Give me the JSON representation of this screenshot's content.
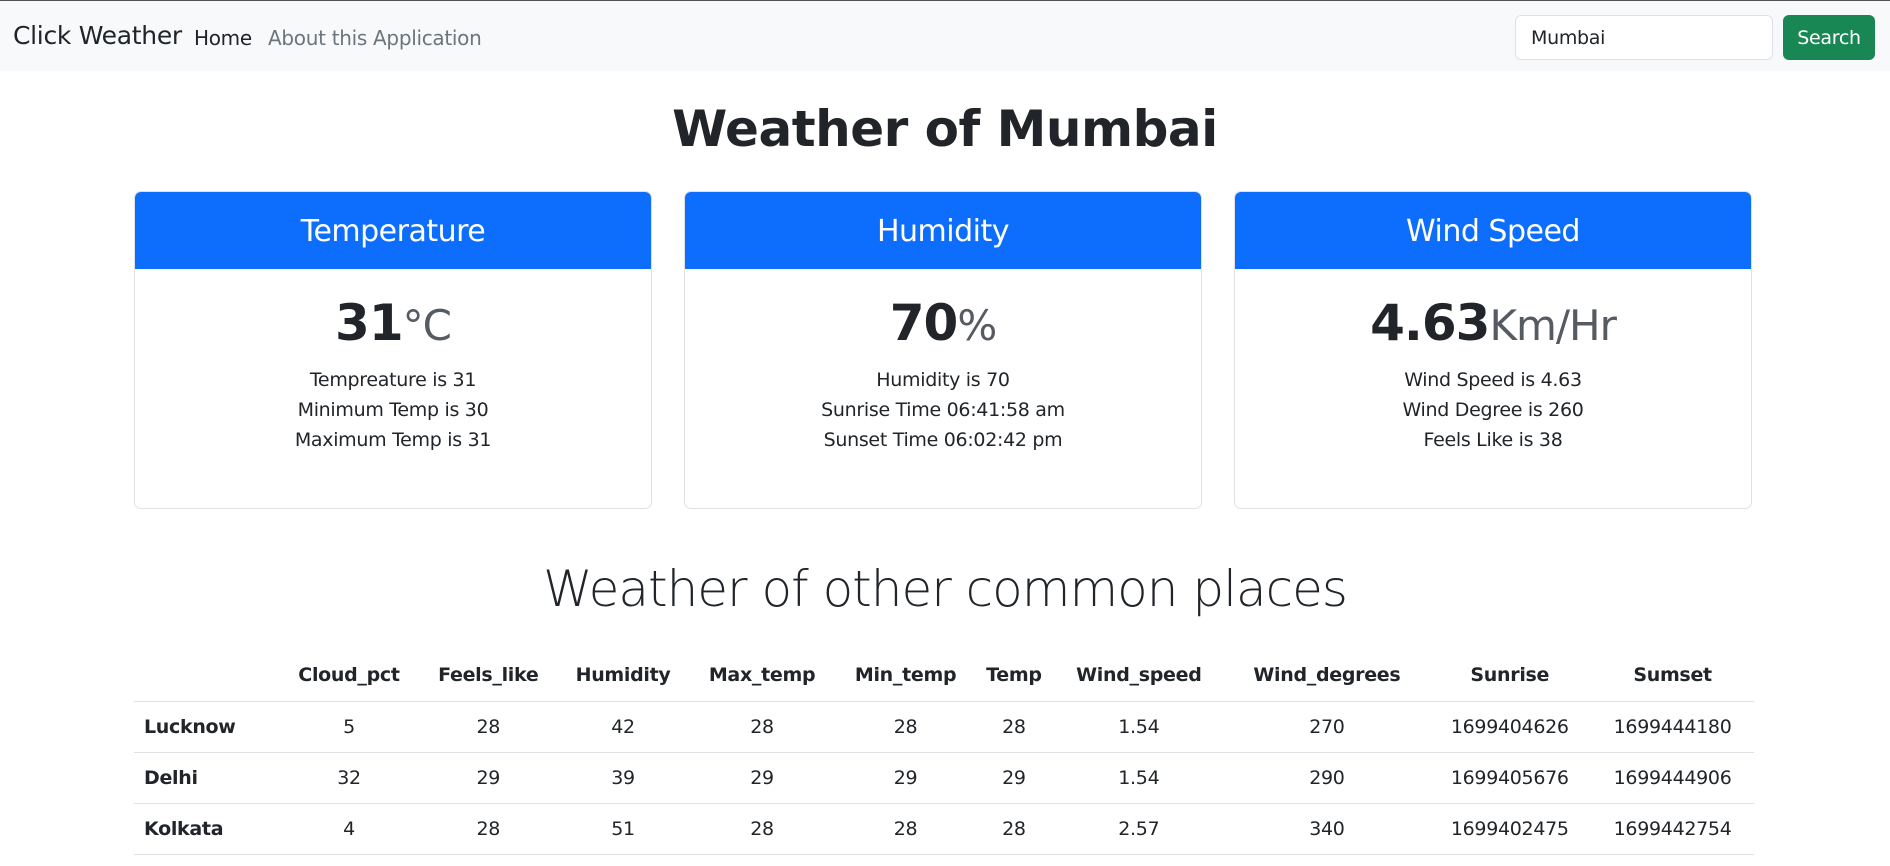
{
  "navbar": {
    "brand": "Click Weather",
    "links": [
      {
        "label": "Home"
      },
      {
        "label": "About this Application"
      }
    ],
    "search": {
      "value": "Mumbai",
      "button_label": "Search"
    }
  },
  "main": {
    "title": "Weather of Mumbai",
    "cards": [
      {
        "header": "Temperature",
        "value": "31",
        "unit": "°C",
        "lines": [
          "Tempreature is 31",
          "Minimum Temp is 30",
          "Maximum Temp is 31"
        ]
      },
      {
        "header": "Humidity",
        "value": "70",
        "unit": "%",
        "lines": [
          "Humidity is 70",
          "Sunrise Time 06:41:58 am",
          "Sunset Time 06:02:42 pm"
        ]
      },
      {
        "header": "Wind Speed",
        "value": "4.63",
        "unit": "Km/Hr",
        "lines": [
          "Wind Speed is 4.63",
          "Wind Degree is 260",
          "Feels Like is 38"
        ]
      }
    ]
  },
  "other_places": {
    "title": "Weather of other common places",
    "columns": [
      "",
      "Cloud_pct",
      "Feels_like",
      "Humidity",
      "Max_temp",
      "Min_temp",
      "Temp",
      "Wind_speed",
      "Wind_degrees",
      "Sunrise",
      "Sumset"
    ],
    "rows": [
      [
        "Lucknow",
        "5",
        "28",
        "42",
        "28",
        "28",
        "28",
        "1.54",
        "270",
        "1699404626",
        "1699444180"
      ],
      [
        "Delhi",
        "32",
        "29",
        "39",
        "29",
        "29",
        "29",
        "1.54",
        "290",
        "1699405676",
        "1699444906"
      ],
      [
        "Kolkata",
        "4",
        "28",
        "51",
        "28",
        "28",
        "28",
        "2.57",
        "340",
        "1699402475",
        "1699442754"
      ]
    ]
  },
  "colors": {
    "navbar_bg": "#f8f9fa",
    "card_header": "#0d6efd",
    "search_button": "#198754"
  }
}
